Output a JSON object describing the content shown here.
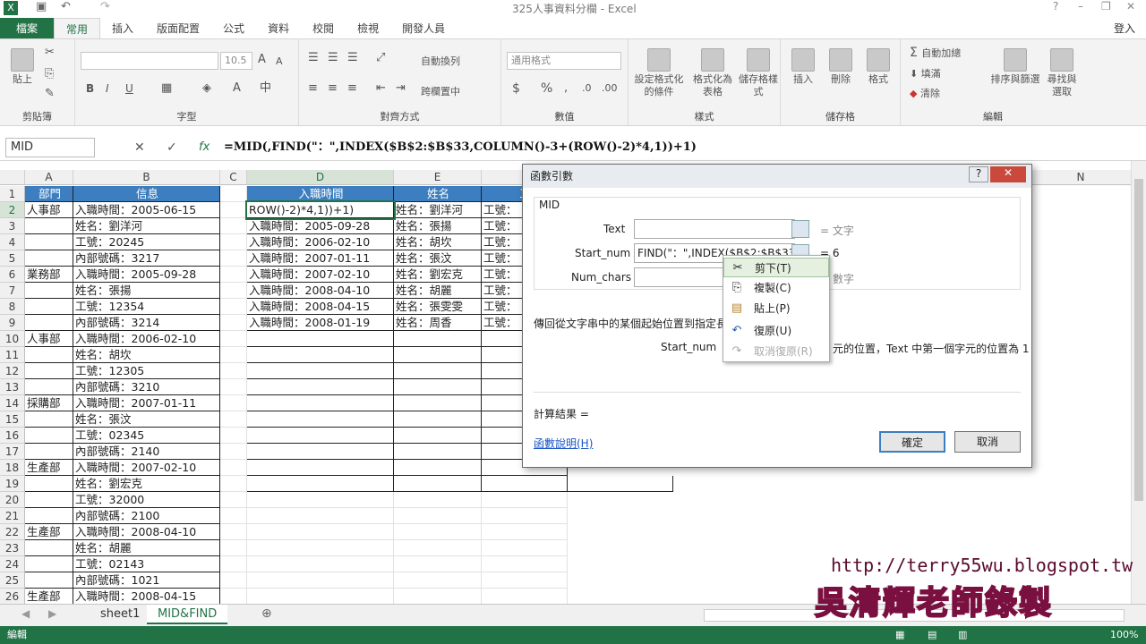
{
  "window": {
    "title": "325人事資料分欄 - Excel",
    "login": "登入"
  },
  "tabs": [
    "檔案",
    "常用",
    "插入",
    "版面配置",
    "公式",
    "資料",
    "校閱",
    "檢視",
    "開發人員"
  ],
  "ribbon": {
    "clipboard": {
      "label": "剪貼簿",
      "paste": "貼上"
    },
    "font": {
      "label": "字型",
      "size": "10.5",
      "bold": "B",
      "italic": "I",
      "underline": "U"
    },
    "alignment": {
      "label": "對齊方式",
      "wrap": "自動換列",
      "merge": "跨欄置中"
    },
    "number": {
      "label": "數值",
      "format": "通用格式",
      "currency": "$",
      "percent": "%"
    },
    "styles": {
      "label": "樣式",
      "cond": "設定格式化的條件",
      "table": "格式化為表格",
      "cell": "儲存格樣式"
    },
    "cells": {
      "label": "儲存格",
      "insert": "插入",
      "delete": "刪除",
      "format": "格式"
    },
    "editing": {
      "label": "編輯",
      "autosum": "自動加總",
      "fill": "填滿",
      "clear": "清除",
      "sort": "排序與篩選",
      "find": "尋找與選取"
    }
  },
  "formula_bar": {
    "namebox": "MID",
    "cancel": "✕",
    "enter": "✓",
    "fx": "fx",
    "formula": "=MID(,FIND(\"：\",INDEX($B$2:$B$33,COLUMN()-3+(ROW()-2)*4,1))+1)"
  },
  "columns": [
    "A",
    "B",
    "C",
    "D",
    "E",
    "F",
    "G",
    "H",
    "I",
    "J",
    "K",
    "L",
    "M",
    "N"
  ],
  "rows": [
    {
      "n": "1",
      "a": "部門",
      "b": "信息"
    },
    {
      "n": "2",
      "a": "人事部",
      "b": "入職時間：2005-06-15"
    },
    {
      "n": "3",
      "a": "",
      "b": "姓名：劉洋河"
    },
    {
      "n": "4",
      "a": "",
      "b": "工號：20245"
    },
    {
      "n": "5",
      "a": "",
      "b": "內部號碼：3217"
    },
    {
      "n": "6",
      "a": "業務部",
      "b": "入職時間：2005-09-28"
    },
    {
      "n": "7",
      "a": "",
      "b": "姓名：張揚"
    },
    {
      "n": "8",
      "a": "",
      "b": "工號：12354"
    },
    {
      "n": "9",
      "a": "",
      "b": "內部號碼：3214"
    },
    {
      "n": "10",
      "a": "人事部",
      "b": "入職時間：2006-02-10"
    },
    {
      "n": "11",
      "a": "",
      "b": "姓名：胡坎"
    },
    {
      "n": "12",
      "a": "",
      "b": "工號：12305"
    },
    {
      "n": "13",
      "a": "",
      "b": "內部號碼：3210"
    },
    {
      "n": "14",
      "a": "採購部",
      "b": "入職時間：2007-01-11"
    },
    {
      "n": "15",
      "a": "",
      "b": "姓名：張汶"
    },
    {
      "n": "16",
      "a": "",
      "b": "工號：02345"
    },
    {
      "n": "17",
      "a": "",
      "b": "內部號碼：2140"
    },
    {
      "n": "18",
      "a": "生產部",
      "b": "入職時間：2007-02-10"
    },
    {
      "n": "19",
      "a": "",
      "b": "姓名：劉宏克"
    },
    {
      "n": "20",
      "a": "",
      "b": "工號：32000"
    },
    {
      "n": "21",
      "a": "",
      "b": "內部號碼：2100"
    },
    {
      "n": "22",
      "a": "生產部",
      "b": "入職時間：2008-04-10"
    },
    {
      "n": "23",
      "a": "",
      "b": "姓名：胡麗"
    },
    {
      "n": "24",
      "a": "",
      "b": "工號：02143"
    },
    {
      "n": "25",
      "a": "",
      "b": "內部號碼：1021"
    },
    {
      "n": "26",
      "a": "生產部",
      "b": "入職時間：2008-04-15"
    }
  ],
  "table2": {
    "headers": [
      "入職時間",
      "姓名",
      "工"
    ],
    "rows": [
      [
        "ROW()-2)*4,1))+1)",
        "姓名：劉洋河",
        "工號："
      ],
      [
        "入職時間：2005-09-28",
        "姓名：張揚",
        "工號："
      ],
      [
        "入職時間：2006-02-10",
        "姓名：胡坎",
        "工號："
      ],
      [
        "入職時間：2007-01-11",
        "姓名：張汶",
        "工號："
      ],
      [
        "入職時間：2007-02-10",
        "姓名：劉宏克",
        "工號："
      ],
      [
        "入職時間：2008-04-10",
        "姓名：胡麗",
        "工號："
      ],
      [
        "入職時間：2008-04-15",
        "姓名：張雯雯",
        "工號："
      ],
      [
        "入職時間：2008-01-19",
        "姓名：周香",
        "工號："
      ]
    ]
  },
  "dialog": {
    "title": "函數引數",
    "func": "MID",
    "text_label": "Text",
    "text_result": "= 文字",
    "start_label": "Start_num",
    "start_value": "FIND(\"：\",INDEX($B$2:$B$33,",
    "start_result": "= 6",
    "num_label": "Num_chars",
    "num_result": "數字",
    "desc": "傳回從文字串中的某個起始位置到指定長",
    "start_desc_label": "Start_num",
    "start_desc": "元的位置，Text 中第一個字元的位置為 1",
    "calc": "計算結果 =",
    "help": "函數說明(H)",
    "ok": "確定",
    "cancel": "取消"
  },
  "context_menu": [
    "剪下(T)",
    "複製(C)",
    "貼上(P)",
    "復原(U)",
    "取消復原(R)"
  ],
  "sheets": [
    "sheet1",
    "MID&FIND"
  ],
  "status": {
    "mode": "編輯",
    "zoom": "100%"
  },
  "watermark": {
    "url": "http://terry55wu.blogspot.tw",
    "author": "吳清輝老師錄製"
  }
}
